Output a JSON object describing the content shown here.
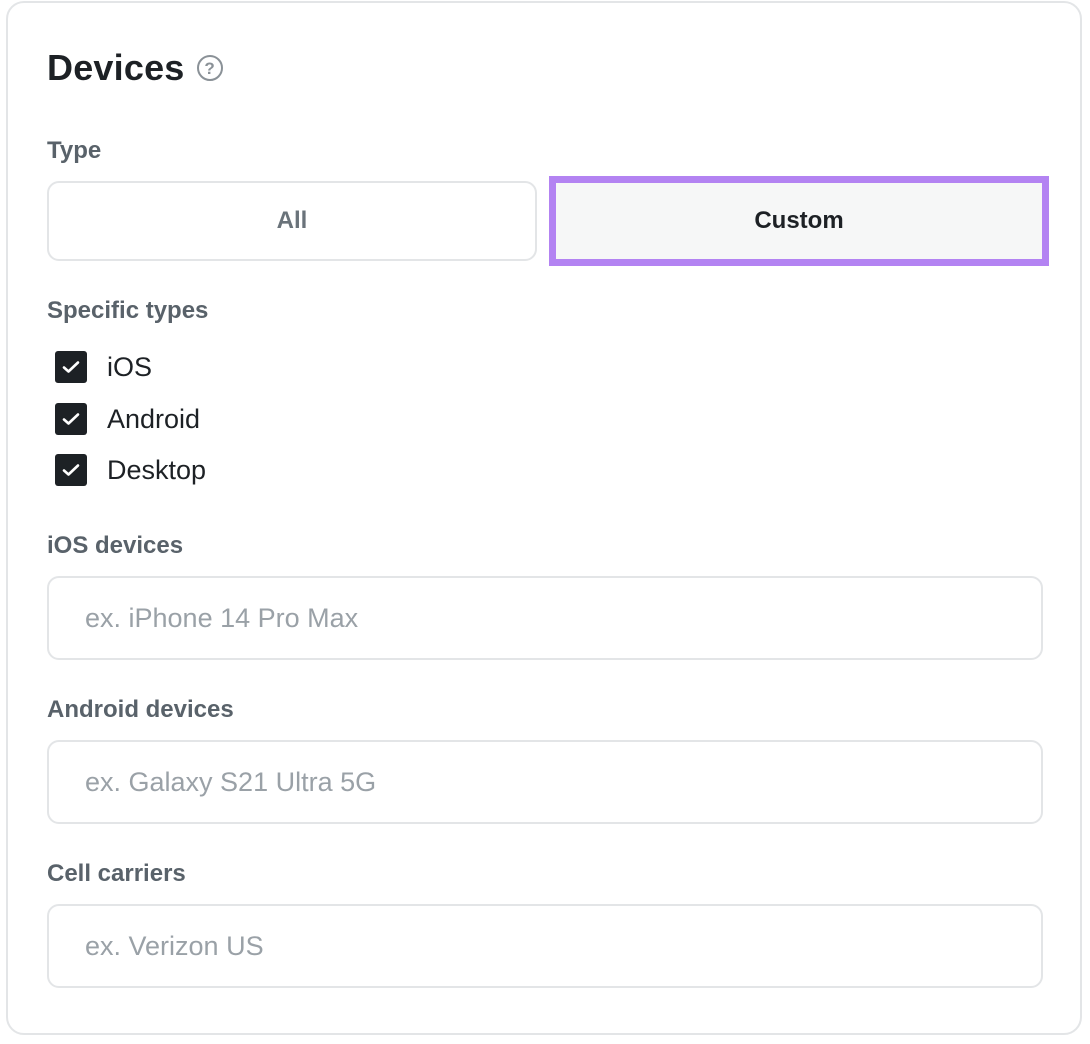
{
  "panel": {
    "title": "Devices",
    "help_icon": "question-circle-icon",
    "help_glyph": "?"
  },
  "type": {
    "label": "Type",
    "options": [
      {
        "label": "All",
        "selected": false
      },
      {
        "label": "Custom",
        "selected": true
      }
    ]
  },
  "specific_types": {
    "label": "Specific types",
    "items": [
      {
        "label": "iOS",
        "checked": true
      },
      {
        "label": "Android",
        "checked": true
      },
      {
        "label": "Desktop",
        "checked": true
      }
    ]
  },
  "ios_devices": {
    "label": "iOS devices",
    "value": "",
    "placeholder": "ex. iPhone 14 Pro Max"
  },
  "android_devices": {
    "label": "Android devices",
    "value": "",
    "placeholder": "ex. Galaxy S21 Ultra 5G"
  },
  "cell_carriers": {
    "label": "Cell carriers",
    "value": "",
    "placeholder": "ex. Verizon US"
  },
  "colors": {
    "focus_outline": "#b383f2",
    "checkbox_fill": "#1d2125",
    "border": "#e3e5e7"
  }
}
